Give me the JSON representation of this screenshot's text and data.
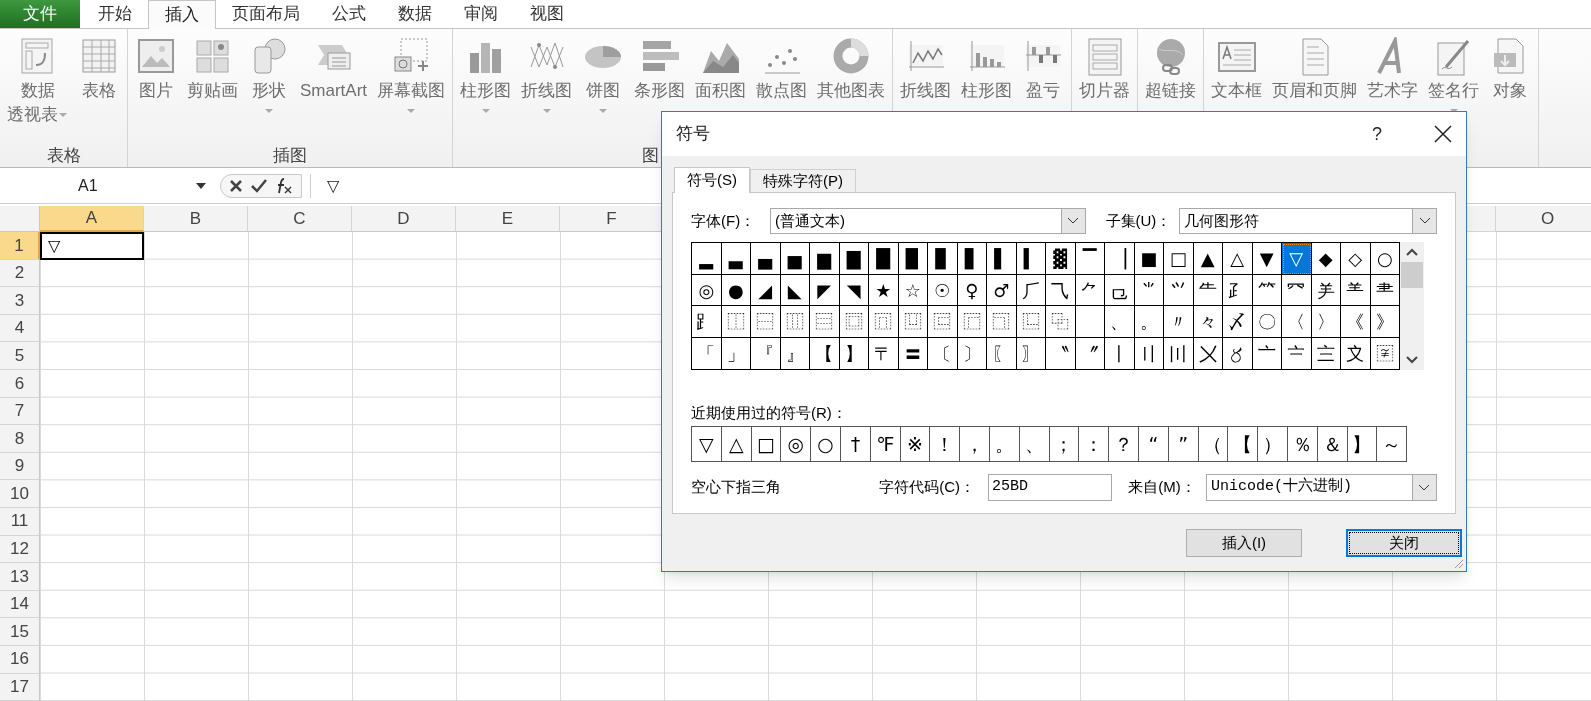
{
  "ribbon": {
    "tabs": [
      {
        "label": "文件",
        "kind": "file",
        "selected": false
      },
      {
        "label": "开始",
        "kind": "tab",
        "selected": false
      },
      {
        "label": "插入",
        "kind": "tab",
        "selected": true
      },
      {
        "label": "页面布局",
        "kind": "tab",
        "selected": false
      },
      {
        "label": "公式",
        "kind": "tab",
        "selected": false
      },
      {
        "label": "数据",
        "kind": "tab",
        "selected": false
      },
      {
        "label": "审阅",
        "kind": "tab",
        "selected": false
      },
      {
        "label": "视图",
        "kind": "tab",
        "selected": false
      }
    ],
    "groups": [
      {
        "label": "表格",
        "buttons": [
          {
            "lines": [
              "数据",
              "透视表"
            ],
            "dropdown": true
          },
          {
            "lines": [
              "表格"
            ],
            "dropdown": false
          }
        ]
      },
      {
        "label": "插图",
        "buttons": [
          {
            "lines": [
              "图片"
            ],
            "dropdown": false
          },
          {
            "lines": [
              "剪贴画"
            ],
            "dropdown": false
          },
          {
            "lines": [
              "形状"
            ],
            "dropdown": true
          },
          {
            "lines": [
              "SmartArt"
            ],
            "dropdown": false
          },
          {
            "lines": [
              "屏幕截图"
            ],
            "dropdown": true
          }
        ]
      },
      {
        "label": "图",
        "buttons": [
          {
            "lines": [
              "柱形图"
            ],
            "dropdown": true
          },
          {
            "lines": [
              "折线图"
            ],
            "dropdown": true
          },
          {
            "lines": [
              "饼图"
            ],
            "dropdown": true
          },
          {
            "lines": [
              "条形图"
            ],
            "dropdown": false
          },
          {
            "lines": [
              "面积图"
            ],
            "dropdown": false
          },
          {
            "lines": [
              "散点图"
            ],
            "dropdown": false
          },
          {
            "lines": [
              "其他图表"
            ],
            "dropdown": false
          }
        ]
      },
      {
        "buttons": [
          {
            "lines": [
              "折线图"
            ],
            "dropdown": false
          },
          {
            "lines": [
              "柱形图"
            ],
            "dropdown": false
          },
          {
            "lines": [
              "盈亏"
            ],
            "dropdown": false
          }
        ]
      },
      {
        "buttons": [
          {
            "lines": [
              "切片器"
            ],
            "dropdown": false
          }
        ]
      },
      {
        "buttons": [
          {
            "lines": [
              "超链接"
            ],
            "dropdown": false
          }
        ]
      },
      {
        "buttons": [
          {
            "lines": [
              "文本框"
            ],
            "dropdown": false
          },
          {
            "lines": [
              "页眉和页脚"
            ],
            "dropdown": false
          },
          {
            "lines": [
              "艺术字"
            ],
            "dropdown": false
          },
          {
            "lines": [
              "签名行"
            ],
            "dropdown": true
          },
          {
            "lines": [
              "对象"
            ],
            "dropdown": false
          }
        ]
      }
    ]
  },
  "formula_bar": {
    "name_box": "A1",
    "formula": "▽"
  },
  "sheet": {
    "columns": [
      {
        "label": "A",
        "selected": true
      },
      {
        "label": "B",
        "selected": false
      },
      {
        "label": "C",
        "selected": false
      },
      {
        "label": "D",
        "selected": false
      },
      {
        "label": "E",
        "selected": false
      },
      {
        "label": "F",
        "selected": false
      }
    ],
    "columns_after_dialog": [
      {
        "label": "O",
        "selected": false
      }
    ],
    "rows": [
      {
        "header": "1",
        "selected": true,
        "cells": [
          "▽"
        ]
      },
      {
        "header": "2",
        "selected": false
      },
      {
        "header": "3",
        "selected": false
      },
      {
        "header": "4",
        "selected": false
      },
      {
        "header": "5",
        "selected": false
      },
      {
        "header": "6",
        "selected": false
      },
      {
        "header": "7",
        "selected": false
      },
      {
        "header": "8",
        "selected": false
      },
      {
        "header": "9",
        "selected": false
      },
      {
        "header": "10",
        "selected": false
      },
      {
        "header": "11",
        "selected": false
      },
      {
        "header": "12",
        "selected": false
      },
      {
        "header": "13",
        "selected": false
      },
      {
        "header": "14",
        "selected": false
      },
      {
        "header": "15",
        "selected": false
      },
      {
        "header": "16",
        "selected": false
      },
      {
        "header": "17",
        "selected": false
      }
    ]
  },
  "symbol_dialog": {
    "title": "符号",
    "help": "?",
    "tabs": [
      {
        "label": "符号(S)",
        "selected": true
      },
      {
        "label": "特殊字符(P)",
        "selected": false
      }
    ],
    "font_label": "字体(F)：",
    "font_value": "(普通文本)",
    "subset_label": "子集(U)：",
    "subset_value": "几何图形符",
    "symbols": [
      [
        {
          "char": "▂",
          "selected": false
        },
        {
          "char": "▃",
          "selected": false
        },
        {
          "char": "▄",
          "selected": false
        },
        {
          "char": "▅",
          "selected": false
        },
        {
          "char": "▆",
          "selected": false
        },
        {
          "char": "▇",
          "selected": false
        },
        {
          "char": "█",
          "selected": false
        },
        {
          "char": "▉",
          "selected": false
        },
        {
          "char": "▊",
          "selected": false
        },
        {
          "char": "▋",
          "selected": false
        },
        {
          "char": "▌",
          "selected": false
        },
        {
          "char": "▍",
          "selected": false
        },
        {
          "char": "▓",
          "selected": false
        },
        {
          "char": "▔",
          "selected": false
        },
        {
          "char": "▕",
          "selected": false
        },
        {
          "char": "■",
          "selected": false
        },
        {
          "char": "□",
          "selected": false
        },
        {
          "char": "▲",
          "selected": false
        },
        {
          "char": "△",
          "selected": false
        },
        {
          "char": "▼",
          "selected": false
        },
        {
          "char": "▽",
          "selected": true
        },
        {
          "char": "◆",
          "selected": false
        },
        {
          "char": "◇",
          "selected": false
        },
        {
          "char": "○",
          "selected": false
        }
      ],
      [
        {
          "char": "◎",
          "selected": false
        },
        {
          "char": "●",
          "selected": false
        },
        {
          "char": "◢",
          "selected": false
        },
        {
          "char": "◣",
          "selected": false
        },
        {
          "char": "◤",
          "selected": false
        },
        {
          "char": "◥",
          "selected": false
        },
        {
          "char": "★",
          "selected": false
        },
        {
          "char": "☆",
          "selected": false
        },
        {
          "char": "☉",
          "selected": false
        },
        {
          "char": "♀",
          "selected": false
        },
        {
          "char": "♂",
          "selected": false
        },
        {
          "char": "⺁",
          "selected": false
        },
        {
          "char": "⺄",
          "selected": false
        },
        {
          "char": "⺈",
          "selected": false
        },
        {
          "char": "⺋",
          "selected": false
        },
        {
          "char": "⺌",
          "selected": false
        },
        {
          "char": "⺍",
          "selected": false
        },
        {
          "char": "⺧",
          "selected": false
        },
        {
          "char": "⺪",
          "selected": false
        },
        {
          "char": "⺮",
          "selected": false
        },
        {
          "char": "⺳",
          "selected": false
        },
        {
          "char": "⺶",
          "selected": false
        },
        {
          "char": "⺷",
          "selected": false
        },
        {
          "char": "⺻",
          "selected": false
        }
      ],
      [
        {
          "char": "⻊",
          "selected": false
        },
        {
          "char": "⿰",
          "selected": false
        },
        {
          "char": "⿱",
          "selected": false
        },
        {
          "char": "⿲",
          "selected": false
        },
        {
          "char": "⿳",
          "selected": false
        },
        {
          "char": "⿴",
          "selected": false
        },
        {
          "char": "⿵",
          "selected": false
        },
        {
          "char": "⿶",
          "selected": false
        },
        {
          "char": "⿷",
          "selected": false
        },
        {
          "char": "⿸",
          "selected": false
        },
        {
          "char": "⿹",
          "selected": false
        },
        {
          "char": "⿺",
          "selected": false
        },
        {
          "char": "⿻",
          "selected": false
        },
        {
          "selected": false
        },
        {
          "char": "、",
          "selected": false
        },
        {
          "char": "。",
          "selected": false
        },
        {
          "char": "〃",
          "selected": false
        },
        {
          "char": "々",
          "selected": false
        },
        {
          "char": "〆",
          "selected": false
        },
        {
          "char": "〇",
          "selected": false
        },
        {
          "char": "〈",
          "selected": false
        },
        {
          "char": "〉",
          "selected": false
        },
        {
          "char": "《",
          "selected": false
        },
        {
          "char": "》",
          "selected": false
        }
      ],
      [
        {
          "char": "「",
          "selected": false
        },
        {
          "char": "」",
          "selected": false
        },
        {
          "char": "『",
          "selected": false
        },
        {
          "char": "』",
          "selected": false
        },
        {
          "char": "【",
          "selected": false
        },
        {
          "char": "】",
          "selected": false
        },
        {
          "char": "〒",
          "selected": false
        },
        {
          "char": "〓",
          "selected": false
        },
        {
          "char": "〔",
          "selected": false
        },
        {
          "char": "〕",
          "selected": false
        },
        {
          "char": "〖",
          "selected": false
        },
        {
          "char": "〗",
          "selected": false
        },
        {
          "char": "〝",
          "selected": false
        },
        {
          "char": "〞",
          "selected": false
        },
        {
          "char": "〡",
          "selected": false
        },
        {
          "char": "〢",
          "selected": false
        },
        {
          "char": "〣",
          "selected": false
        },
        {
          "char": "〤",
          "selected": false
        },
        {
          "char": "〥",
          "selected": false
        },
        {
          "char": "〦",
          "selected": false
        },
        {
          "char": "〧",
          "selected": false
        },
        {
          "char": "〨",
          "selected": false
        },
        {
          "char": "〩",
          "selected": false
        },
        {
          "char": "〾",
          "selected": false
        }
      ]
    ],
    "recent_label": "近期使用过的符号(R)：",
    "recent": [
      "▽",
      "△",
      "□",
      "◎",
      "○",
      "†",
      "℉",
      "※",
      "！",
      "，",
      "。",
      "、",
      "；",
      "：",
      "？",
      "“",
      "”",
      "（",
      "【",
      "）",
      "％",
      "＆",
      "】",
      "～"
    ],
    "char_name": "空心下指三角",
    "code_label": "字符代码(C)：",
    "code_value": "25BD",
    "from_label": "来自(M)：",
    "from_value": "Unicode(十六进制)",
    "buttons": [
      {
        "label": "插入(I)",
        "focused": false
      },
      {
        "label": "关闭",
        "focused": true
      }
    ]
  }
}
